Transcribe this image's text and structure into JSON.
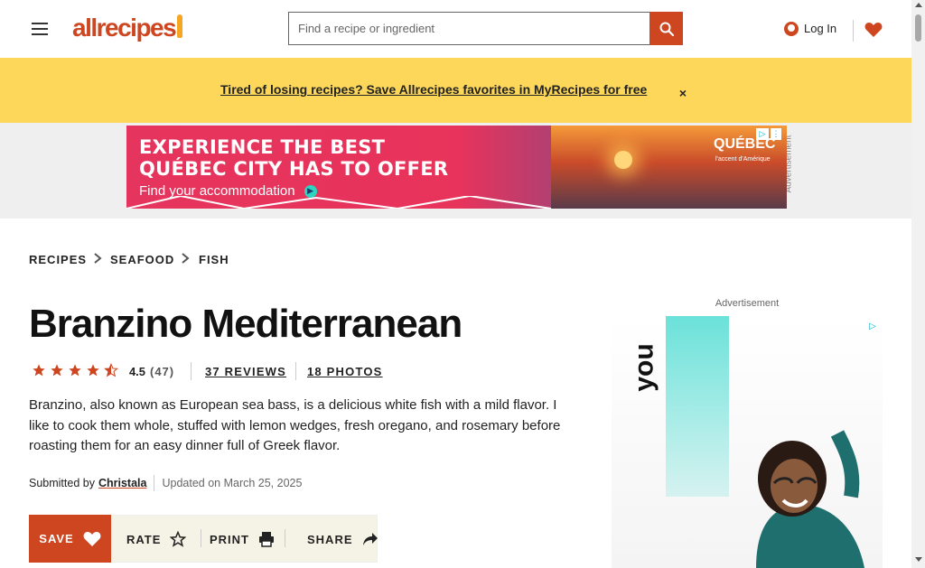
{
  "header": {
    "logo_text": "allrecipes",
    "search_placeholder": "Find a recipe or ingredient",
    "login_label": "Log In",
    "accent_color": "#ce4620"
  },
  "promo": {
    "text": "Tired of losing recipes? Save Allrecipes favorites in MyRecipes for free",
    "close_label": "×",
    "background_color": "#fcd75a"
  },
  "ad_banner": {
    "label": "Advertisement",
    "line1": "EXPERIENCE THE BEST",
    "line2": "QUÉBEC CITY HAS TO OFFER",
    "line3": "Find your accommodation",
    "brand": "QUÉBEC",
    "brand_sub": "l'accent d'Amérique"
  },
  "breadcrumbs": [
    {
      "label": "RECIPES"
    },
    {
      "label": "SEAFOOD"
    },
    {
      "label": "FISH"
    }
  ],
  "recipe": {
    "title": "Branzino Mediterranean",
    "rating_value": "4.5",
    "rating_stars": 4.5,
    "rating_count": "(47)",
    "reviews_label": "37 REVIEWS",
    "photos_label": "18 PHOTOS",
    "description": "Branzino, also known as European sea bass, is a delicious white fish with a mild flavor. I like to cook them whole, stuffed with lemon wedges, fresh oregano, and rosemary before roasting them for an easy dinner full of Greek flavor.",
    "submitted_by_label": "Submitted by",
    "author": "Christala",
    "updated": "Updated on March 25, 2025"
  },
  "actions": {
    "save_label": "SAVE",
    "rate_label": "RATE",
    "print_label": "PRINT",
    "share_label": "SHARE"
  },
  "right_ad": {
    "label": "Advertisement",
    "text": "you"
  },
  "icons": {
    "menu": "hamburger-menu-icon",
    "search": "search-icon",
    "user": "user-icon",
    "heart": "heart-icon",
    "star": "star-icon",
    "print": "printer-icon",
    "share": "share-arrow-icon",
    "chevron": "chevron-right-icon"
  }
}
